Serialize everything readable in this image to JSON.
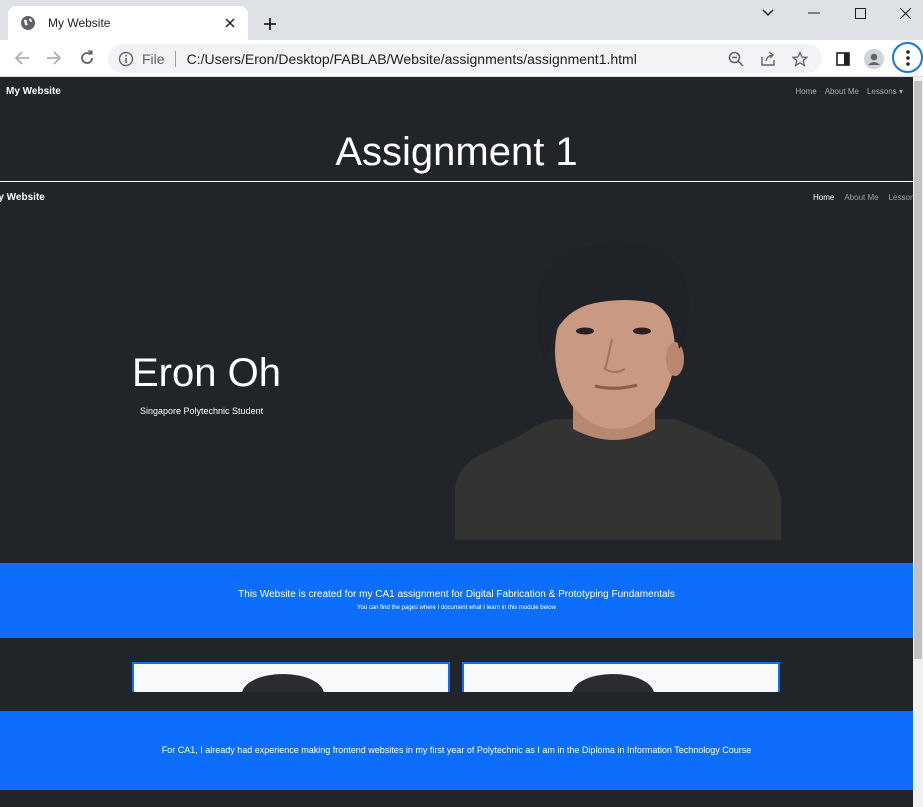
{
  "browser": {
    "tab_title": "My Website",
    "address": {
      "scheme_label": "File",
      "url": "C:/Users/Eron/Desktop/FABLAB/Website/assignments/assignment1.html"
    }
  },
  "site": {
    "brand": "My Website",
    "nav": [
      "Home",
      "About Me",
      "Lessons"
    ],
    "heading": "Assignment 1"
  },
  "embed": {
    "brand": "My Website",
    "nav": {
      "home": "Home",
      "about": "About Me",
      "lessons": "Lessons"
    },
    "hero": {
      "name": "Eron Oh",
      "subtitle": "Singapore Polytechnic Student"
    },
    "banner": {
      "main": "This Website is created for my CA1 assignment for Digital Fabrication & Prototyping Fundamentals",
      "sub": "You can find the pages where I document what I learn in this module below"
    },
    "cards": [
      {},
      {}
    ],
    "section2": {
      "text": "For CA1, I already had experience making frontend websites in my first year of Polytechnic as I am in the Diploma in Information Technology Course"
    }
  },
  "colors": {
    "page_bg": "#212529",
    "accent": "#0d6efd",
    "chrome": "#dee1e6"
  }
}
